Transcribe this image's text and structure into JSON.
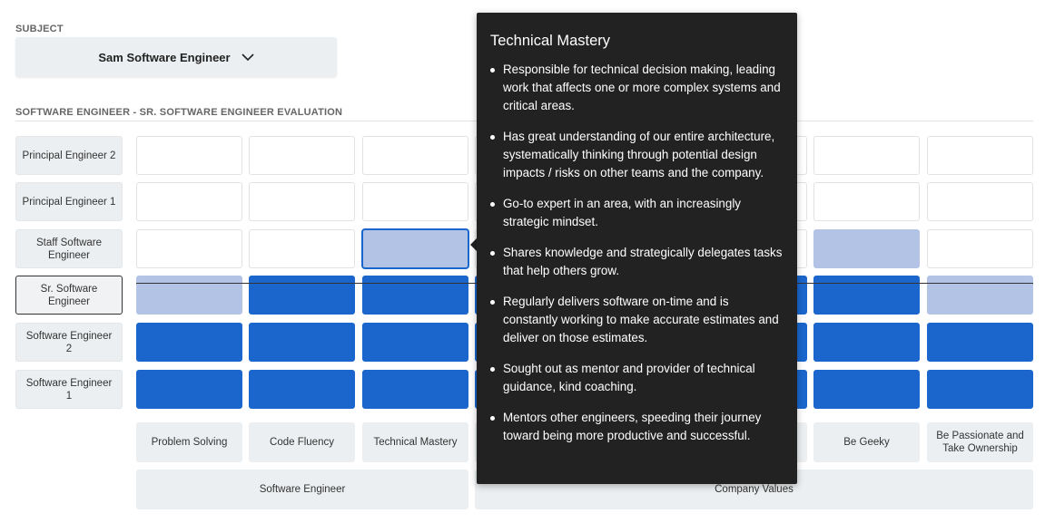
{
  "subject": {
    "label": "SUBJECT",
    "selected": "Sam Software Engineer"
  },
  "evaluation": {
    "title": "SOFTWARE ENGINEER - SR. SOFTWARE ENGINEER EVALUATION",
    "levels": [
      "Principal Engineer 2",
      "Principal Engineer 1",
      "Staff Software Engineer",
      "Sr. Software Engineer",
      "Software Engineer 2",
      "Software Engineer 1"
    ],
    "selected_level": "Sr. Software Engineer",
    "columns": [
      "Problem Solving",
      "Code Fluency",
      "Technical Mastery",
      "",
      "",
      "",
      "Be Geeky",
      "Be Passionate and Take Ownership"
    ],
    "groups": [
      {
        "label": "Software Engineer",
        "span": 3
      },
      {
        "label": "Company Values",
        "span": 5
      }
    ],
    "grid": [
      [
        "empty",
        "empty",
        "empty",
        "empty",
        "empty",
        "empty",
        "empty",
        "empty"
      ],
      [
        "empty",
        "empty",
        "empty",
        "empty",
        "empty",
        "empty",
        "empty",
        "empty"
      ],
      [
        "empty",
        "empty",
        "light",
        "empty",
        "empty",
        "empty",
        "light",
        "empty"
      ],
      [
        "light",
        "dark",
        "dark",
        "dark",
        "dark",
        "dark",
        "dark",
        "light"
      ],
      [
        "dark",
        "dark",
        "dark",
        "dark",
        "dark",
        "dark",
        "dark",
        "dark"
      ],
      [
        "dark",
        "dark",
        "dark",
        "dark",
        "dark",
        "dark",
        "dark",
        "dark"
      ]
    ],
    "focused_cell": {
      "level": "Staff Software Engineer",
      "column": "Technical Mastery"
    },
    "colors": {
      "achieved": "#1a66cc",
      "partial": "#b3c3e6",
      "empty": "#ffffff"
    }
  },
  "tooltip": {
    "title": "Technical Mastery",
    "items": [
      "Responsible for technical decision making, leading work that affects one or more complex systems and critical areas.",
      "Has great understanding of our entire architecture, systematically thinking through potential design impacts / risks on other teams and the company.",
      "Go-to expert in an area, with an increasingly strategic mindset.",
      "Shares knowledge and strategically delegates tasks that help others grow.",
      "Regularly delivers software on-time and is constantly working to make accurate estimates and deliver on those estimates.",
      "Sought out as mentor and provider of technical guidance, kind coaching.",
      "Mentors other engineers, speeding their journey toward being more productive and successful."
    ]
  }
}
